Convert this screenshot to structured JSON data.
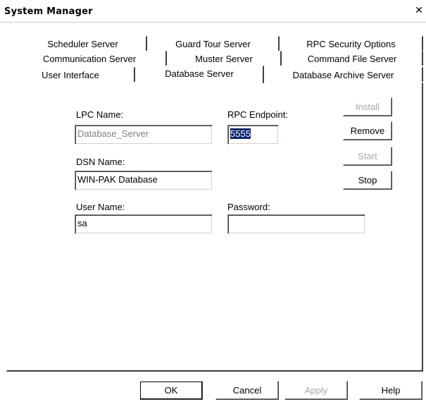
{
  "window": {
    "title": "System Manager",
    "close_glyph": "✕"
  },
  "tabs": {
    "row1": [
      "Scheduler Server",
      "Guard Tour Server",
      "RPC Security Options"
    ],
    "row2": [
      "Communication Server",
      "Muster Server",
      "Command File Server"
    ],
    "row3": [
      "User Interface",
      "Database Server",
      "Database Archive Server"
    ],
    "active": "Database Server"
  },
  "form": {
    "lpc_name_label": "LPC Name:",
    "lpc_name_value": "Database_Server",
    "rpc_endpoint_label": "RPC Endpoint:",
    "rpc_endpoint_value": "5555",
    "dsn_name_label": "DSN Name:",
    "dsn_name_value": "WIN-PAK Database",
    "user_name_label": "User Name:",
    "user_name_value": "sa",
    "password_label": "Password:",
    "password_value": ""
  },
  "side_buttons": {
    "install": "Install",
    "remove": "Remove",
    "start": "Start",
    "stop": "Stop"
  },
  "footer_buttons": {
    "ok": "OK",
    "cancel": "Cancel",
    "apply": "Apply",
    "help": "Help"
  }
}
